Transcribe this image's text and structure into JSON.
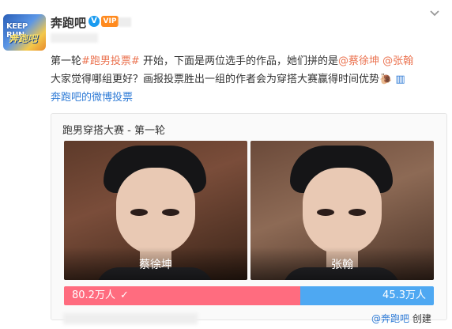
{
  "author": {
    "name": "奔跑吧",
    "avatar_text_a": "KEEP RUN",
    "avatar_text_b": "奔跑吧",
    "verified_icon": "verified-v-icon",
    "badge_icon": "fan-badge-icon"
  },
  "post": {
    "line1_prefix": "第一轮",
    "hashtag": "#跑男投票#",
    "line1_mid": " 开始，下面是两位选手的作品，她们拼的是",
    "mention1": "@蔡徐坤",
    "space": " ",
    "mention2": "@张翰",
    "line2": "大家觉得哪组更好？画报投票胜出一组的作者会为穿搭大赛赢得时间优势",
    "vote_link": "奔跑吧的微博投票"
  },
  "vote": {
    "title": "跑男穿搭大赛 - 第一轮",
    "options": [
      {
        "name": "蔡徐坤",
        "votes_label": "80.2万人",
        "votes_wan": 80.2,
        "color": "#ff6c7f"
      },
      {
        "name": "张翰",
        "votes_label": "45.3万人",
        "votes_wan": 45.3,
        "color": "#4ea8f2"
      }
    ],
    "creator_prefix": "",
    "creator_user": "@奔跑吧",
    "creator_suffix": " 创建"
  }
}
